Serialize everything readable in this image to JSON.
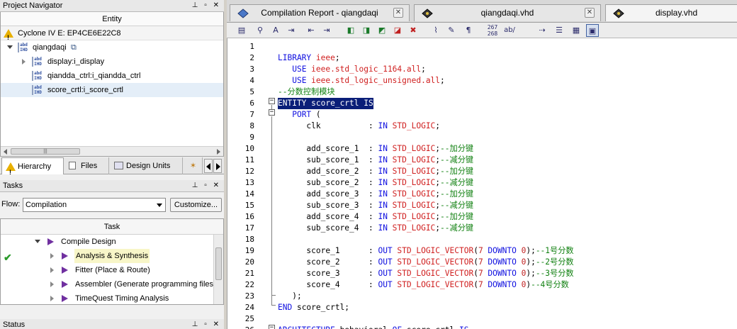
{
  "project_navigator": {
    "title": "Project Navigator",
    "column_header": "Entity",
    "device": "Cyclone IV E: EP4CE6E22C8",
    "top_entity": "qiangdaqi",
    "children": [
      {
        "label": "display:i_display",
        "expandable": true
      },
      {
        "label": "qiandda_ctrl:i_qiandda_ctrl",
        "expandable": false
      },
      {
        "label": "score_crtl:i_score_crtl",
        "expandable": false,
        "selected": true
      }
    ],
    "chip_icon_text": "abd\nIHD",
    "tabs": [
      "Hierarchy",
      "Files",
      "Design Units"
    ]
  },
  "tasks": {
    "title": "Tasks",
    "flow_label": "Flow:",
    "flow_value": "Compilation",
    "customize_label": "Customize...",
    "column_header": "Task",
    "items": [
      {
        "label": "Compile Design",
        "level": 0,
        "expanded": true,
        "done": false
      },
      {
        "label": "Analysis & Synthesis",
        "level": 1,
        "done": true,
        "highlight": true
      },
      {
        "label": "Fitter (Place & Route)",
        "level": 1,
        "done": false
      },
      {
        "label": "Assembler (Generate programming files)",
        "level": 1,
        "done": false
      },
      {
        "label": "TimeQuest Timing Analysis",
        "level": 1,
        "done": false
      }
    ]
  },
  "status": {
    "title": "Status"
  },
  "editor": {
    "tabs": [
      {
        "label": "Compilation Report - qiangdaqi",
        "active": false
      },
      {
        "label": "qiangdaqi.vhd",
        "active": false
      },
      {
        "label": "display.vhd",
        "active": true
      }
    ],
    "toolbar_numbers_top": "267",
    "toolbar_numbers_bottom": "268",
    "toolbar_ab": "ab/",
    "lines": [
      {
        "n": "1",
        "t": []
      },
      {
        "n": "2",
        "t": [
          [
            "kw",
            "LIBRARY "
          ],
          [
            "ty",
            "ieee"
          ],
          [
            "id",
            ";"
          ]
        ]
      },
      {
        "n": "3",
        "t": [
          [
            "id",
            "   "
          ],
          [
            "kw",
            "USE "
          ],
          [
            "ty",
            "ieee.std_logic_1164.all"
          ],
          [
            "id",
            ";"
          ]
        ]
      },
      {
        "n": "4",
        "t": [
          [
            "id",
            "   "
          ],
          [
            "kw",
            "USE "
          ],
          [
            "ty",
            "ieee.std_logic_unsigned.all"
          ],
          [
            "id",
            ";"
          ]
        ]
      },
      {
        "n": "5",
        "t": [
          [
            "cm",
            "--分数控制模块"
          ]
        ]
      },
      {
        "n": "6",
        "t": [
          [
            "kw",
            "ENTITY "
          ],
          [
            "id",
            "score_crtl "
          ],
          [
            "kw",
            "IS"
          ]
        ],
        "selected": true
      },
      {
        "n": "7",
        "t": [
          [
            "id",
            "   "
          ],
          [
            "kw",
            "PORT "
          ],
          [
            "id",
            "("
          ]
        ]
      },
      {
        "n": "8",
        "t": [
          [
            "id",
            "      clk          : "
          ],
          [
            "kw",
            "IN "
          ],
          [
            "ty",
            "STD_LOGIC"
          ],
          [
            "id",
            ";"
          ]
        ]
      },
      {
        "n": "9",
        "t": []
      },
      {
        "n": "10",
        "t": [
          [
            "id",
            "      add_score_1  : "
          ],
          [
            "kw",
            "IN "
          ],
          [
            "ty",
            "STD_LOGIC"
          ],
          [
            "id",
            ";"
          ],
          [
            "cm",
            "--加分键"
          ]
        ]
      },
      {
        "n": "11",
        "t": [
          [
            "id",
            "      sub_score_1  : "
          ],
          [
            "kw",
            "IN "
          ],
          [
            "ty",
            "STD_LOGIC"
          ],
          [
            "id",
            ";"
          ],
          [
            "cm",
            "--减分键"
          ]
        ]
      },
      {
        "n": "12",
        "t": [
          [
            "id",
            "      add_score_2  : "
          ],
          [
            "kw",
            "IN "
          ],
          [
            "ty",
            "STD_LOGIC"
          ],
          [
            "id",
            ";"
          ],
          [
            "cm",
            "--加分键"
          ]
        ]
      },
      {
        "n": "13",
        "t": [
          [
            "id",
            "      sub_score_2  : "
          ],
          [
            "kw",
            "IN "
          ],
          [
            "ty",
            "STD_LOGIC"
          ],
          [
            "id",
            ";"
          ],
          [
            "cm",
            "--减分键"
          ]
        ]
      },
      {
        "n": "14",
        "t": [
          [
            "id",
            "      add_score_3  : "
          ],
          [
            "kw",
            "IN "
          ],
          [
            "ty",
            "STD_LOGIC"
          ],
          [
            "id",
            ";"
          ],
          [
            "cm",
            "--加分键"
          ]
        ]
      },
      {
        "n": "15",
        "t": [
          [
            "id",
            "      sub_score_3  : "
          ],
          [
            "kw",
            "IN "
          ],
          [
            "ty",
            "STD_LOGIC"
          ],
          [
            "id",
            ";"
          ],
          [
            "cm",
            "--减分键"
          ]
        ]
      },
      {
        "n": "16",
        "t": [
          [
            "id",
            "      add_score_4  : "
          ],
          [
            "kw",
            "IN "
          ],
          [
            "ty",
            "STD_LOGIC"
          ],
          [
            "id",
            ";"
          ],
          [
            "cm",
            "--加分键"
          ]
        ]
      },
      {
        "n": "17",
        "t": [
          [
            "id",
            "      sub_score_4  : "
          ],
          [
            "kw",
            "IN "
          ],
          [
            "ty",
            "STD_LOGIC"
          ],
          [
            "id",
            ";"
          ],
          [
            "cm",
            "--减分键"
          ]
        ]
      },
      {
        "n": "18",
        "t": []
      },
      {
        "n": "19",
        "t": [
          [
            "id",
            "      score_1      : "
          ],
          [
            "kw",
            "OUT "
          ],
          [
            "ty",
            "STD_LOGIC_VECTOR"
          ],
          [
            "id",
            "("
          ],
          [
            "nm",
            "7 "
          ],
          [
            "kw",
            "DOWNTO "
          ],
          [
            "nm",
            "0"
          ],
          [
            "id",
            ");"
          ],
          [
            "cm",
            "--1号分数"
          ]
        ]
      },
      {
        "n": "20",
        "t": [
          [
            "id",
            "      score_2      : "
          ],
          [
            "kw",
            "OUT "
          ],
          [
            "ty",
            "STD_LOGIC_VECTOR"
          ],
          [
            "id",
            "("
          ],
          [
            "nm",
            "7 "
          ],
          [
            "kw",
            "DOWNTO "
          ],
          [
            "nm",
            "0"
          ],
          [
            "id",
            ");"
          ],
          [
            "cm",
            "--2号分数"
          ]
        ]
      },
      {
        "n": "21",
        "t": [
          [
            "id",
            "      score_3      : "
          ],
          [
            "kw",
            "OUT "
          ],
          [
            "ty",
            "STD_LOGIC_VECTOR"
          ],
          [
            "id",
            "("
          ],
          [
            "nm",
            "7 "
          ],
          [
            "kw",
            "DOWNTO "
          ],
          [
            "nm",
            "0"
          ],
          [
            "id",
            ");"
          ],
          [
            "cm",
            "--3号分数"
          ]
        ]
      },
      {
        "n": "22",
        "t": [
          [
            "id",
            "      score_4      : "
          ],
          [
            "kw",
            "OUT "
          ],
          [
            "ty",
            "STD_LOGIC_VECTOR"
          ],
          [
            "id",
            "("
          ],
          [
            "nm",
            "7 "
          ],
          [
            "kw",
            "DOWNTO "
          ],
          [
            "nm",
            "0"
          ],
          [
            "id",
            ")"
          ],
          [
            "cm",
            "--4号分数"
          ]
        ]
      },
      {
        "n": "23",
        "t": [
          [
            "id",
            "   );"
          ]
        ]
      },
      {
        "n": "24",
        "t": [
          [
            "kw",
            "END "
          ],
          [
            "id",
            "score_crtl;"
          ]
        ]
      },
      {
        "n": "25",
        "t": []
      },
      {
        "n": "26",
        "t": [
          [
            "kw",
            "ARCHITECTURE "
          ],
          [
            "id",
            "behavioral "
          ],
          [
            "kw",
            "OF "
          ],
          [
            "id",
            "score_crtl "
          ],
          [
            "kw",
            "IS"
          ]
        ]
      }
    ]
  },
  "colors": {
    "keyword": "#1010e0",
    "type": "#d02020",
    "comment": "#108010",
    "selection": "#0a1e78"
  }
}
